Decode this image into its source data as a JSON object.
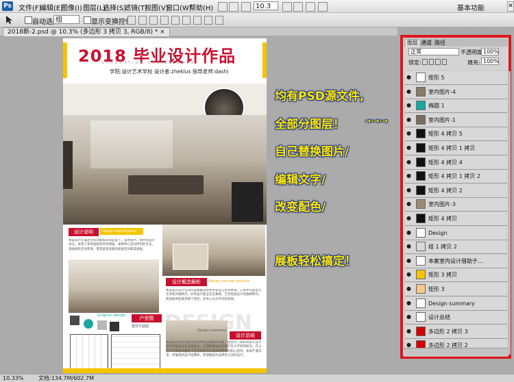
{
  "app": {
    "logo": "Ps",
    "menus": [
      "文件(F)",
      "编辑(E)",
      "图像(I)",
      "图层(L)",
      "选择(S)",
      "滤镜(T)",
      "视图(V)",
      "窗口(W)",
      "帮助(H)"
    ],
    "zoom_select": "10.3",
    "workspace": "基本功能",
    "window_buttons": [
      "—",
      "▭",
      "✕"
    ]
  },
  "options": {
    "auto_select_label": "自动选择:",
    "auto_select_value": "组",
    "show_transform_label": "显示变换控件"
  },
  "document": {
    "tab_title": "2018新-2.psd @ 10.3% (多边形 3 拷贝 3, RGB/8) *",
    "tab_close": "×"
  },
  "status": {
    "zoom": "10.33%",
    "doc_size": "文档:134.7M/602.7M"
  },
  "poster": {
    "title": "2018 毕业设计作品",
    "title_sub": "GRADUATION DESIGN WORK",
    "info": "学院:设计艺术学校   设计者:zheklus   指导老师:dashi",
    "section1_label": "设计说明",
    "section1_en": "Design specification",
    "section1_body": "本案设计在满足空间功能需求的前提下，运用现代、简约的设计语言，体现了休闲宽松的时代特质。采用中心空间序列的手法，减弱视觉空间率调，营造舒适宽敞的起居空间和美观性。",
    "section2_label": "设计概念解析",
    "section2_en": "Design concept analysis",
    "section2_body": "本案室内设计空间作品根据过程中开拿自己主导原则，它帮手作品室元元消初间线特点，好的设计能全实支重要。它对恰美设计的独特原均，而后能中促来其每个世纪，吃中心与众不同的效果。",
    "graphic_label": "Graphic design",
    "floorplan_label": "户型图",
    "floorplan_sub": "整体平面图",
    "summary_en": "Design summary",
    "summary_label": "设计总结",
    "summary_body": "本案室内设计借助于生活中常见相关的风格，结合为一体布局安元设计设计的相应加互的规划合，它便概要采好的要们在大学到的知识。在以力十尺安画体面后了自己的努力以及如另老师的耐心指导。本案严谨实求，开展指新设计经典体，完成精美作品特色之间的设计。",
    "watermark": "DESIGN"
  },
  "annotations": {
    "line1": "均有PSD源文件,",
    "line2": "全部分图层！",
    "line3": "自己替换图片/",
    "line4": "编辑文字/",
    "line5": "改变配色/",
    "line6": "展板轻松搞定！",
    "arrow": "→·→·→"
  },
  "layers_panel": {
    "tabs": [
      "图层",
      "通道",
      "路径"
    ],
    "blend_mode": "正常",
    "opacity_label": "不透明度:",
    "opacity_value": "100%",
    "lock_label": "锁定:",
    "fill_label": "填充:",
    "fill_value": "100%",
    "layers": [
      {
        "name": "矩形 5",
        "thumb": "#ffffff"
      },
      {
        "name": "室内图片-4",
        "thumb": "#8a7a6a"
      },
      {
        "name": "椭圆 1",
        "thumb": "#19a8a0"
      },
      {
        "name": "室内图片-1",
        "thumb": "#7a6e62"
      },
      {
        "name": "矩形 4 拷贝 5",
        "thumb": "#111111"
      },
      {
        "name": "矩形 4 拷贝 1 拷贝",
        "thumb": "#111111"
      },
      {
        "name": "矩形 4 拷贝 4",
        "thumb": "#111111"
      },
      {
        "name": "矩形 4 拷贝 1 拷贝 2",
        "thumb": "#111111"
      },
      {
        "name": "矩形 4 拷贝 2",
        "thumb": "#111111"
      },
      {
        "name": "室内图片-3",
        "thumb": "#9a8a72"
      },
      {
        "name": "矩形 4 拷贝",
        "thumb": "#111111"
      },
      {
        "name": "Design",
        "thumb": "#ffffff"
      },
      {
        "name": "组 1 拷贝 2",
        "thumb": "#d8d8d8"
      },
      {
        "name": "本案室内设计借助于...",
        "thumb": "#ffffff"
      },
      {
        "name": "矩形 3 拷贝",
        "thumb": "#f5c400"
      },
      {
        "name": "矩形 3",
        "thumb": "#f7c88a"
      },
      {
        "name": "Design summary",
        "thumb": "#ffffff"
      },
      {
        "name": "设计总结",
        "thumb": "#ffffff"
      },
      {
        "name": "多边形 2 拷贝 3",
        "thumb": "#d40000"
      },
      {
        "name": "多边形 2 拷贝 2",
        "thumb": "#d40000"
      }
    ]
  }
}
